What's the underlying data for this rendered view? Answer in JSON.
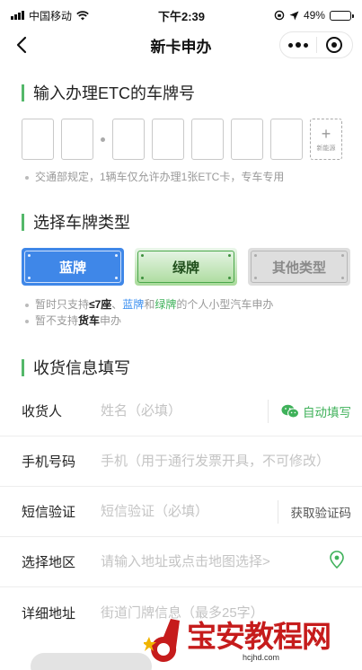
{
  "status_bar": {
    "carrier": "中国移动",
    "time": "下午2:39",
    "battery": "49%",
    "battery_level": 0.49
  },
  "nav": {
    "title": "新卡申办"
  },
  "plate_section": {
    "title": "输入办理ETC的车牌号",
    "new_energy_label": "新能源",
    "note": "交通部规定，1辆车仅允许办理1张ETC卡，专车专用"
  },
  "type_section": {
    "title": "选择车牌类型",
    "buttons": [
      {
        "label": "蓝牌",
        "color": "#3f87e8"
      },
      {
        "label": "绿牌",
        "color": "#a9da9a"
      },
      {
        "label": "其他类型",
        "color": "#dedede"
      }
    ],
    "note1": {
      "prefix": "暂时只支持",
      "seats": "≤7座",
      "sep": "、",
      "blue": "蓝牌",
      "and": "和",
      "green": "绿牌",
      "suffix": "的个人小型汽车申办"
    },
    "note2": {
      "prefix": "暂不支持",
      "truck": "货车",
      "suffix": "申办"
    }
  },
  "shipping_section": {
    "title": "收货信息填写",
    "fields": [
      {
        "label": "收货人",
        "placeholder": "姓名（必填）",
        "action": "自动填写"
      },
      {
        "label": "手机号码",
        "placeholder": "手机（用于通行发票开具，不可修改）"
      },
      {
        "label": "短信验证",
        "placeholder": "短信验证（必填）",
        "action": "获取验证码"
      },
      {
        "label": "选择地区",
        "placeholder": "请输入地址或点击地图选择>"
      },
      {
        "label": "详细地址",
        "placeholder": "街道门牌信息（最多25字）"
      }
    ]
  },
  "watermark": {
    "text": "宝安教程网",
    "url": "hcjhd.com"
  },
  "colors": {
    "accent_green": "#3fb15a",
    "accent_blue": "#3b8ff0",
    "watermark_red": "#c61c1c"
  }
}
